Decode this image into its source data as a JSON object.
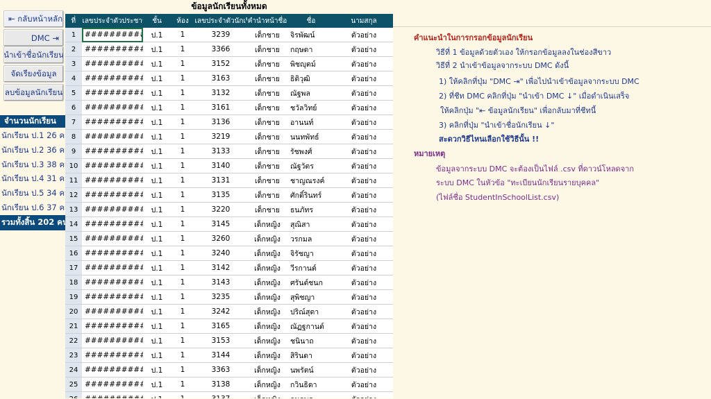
{
  "left_panel": {
    "back_button": "⇤ กลับหน้าหลัก",
    "dmc_button": "DMC ⇥",
    "import_button": "นำเข้าชื่อนักเรียน",
    "sort_button": "จัดเรียงข้อมูล",
    "delete_button": "ลบข้อมูลนักเรียน",
    "count_header": "จำนวนนักเรียน",
    "counts": [
      "นักเรียน ป.1  26 คน",
      "นักเรียน ป.2  36 คน",
      "นักเรียน ป.3  38 คน",
      "นักเรียน ป.4  31 คน",
      "นักเรียน ป.5  34 คน",
      "นักเรียน ป.6  37 คน"
    ],
    "total": "รวมทั้งสิ้น  202  คน"
  },
  "sheet": {
    "title": "ข้อมูลนักเรียนทั้งหมด",
    "columns": [
      "ที่",
      "เลขประจำตัวประชาชน",
      "ชั้น",
      "ห้อง",
      "เลขประจำตัวนักเรียน",
      "คำนำหน้าชื่อ",
      "ชื่อ",
      "นามสกุล"
    ],
    "rows": [
      [
        "1",
        "###############",
        "ป.1",
        "1",
        "3239",
        "เด็กชาย",
        "จิรพัฒน์",
        "ตัวอย่าง"
      ],
      [
        "2",
        "###############",
        "ป.1",
        "1",
        "3366",
        "เด็กชาย",
        "กฤษดา",
        "ตัวอย่าง"
      ],
      [
        "3",
        "###############",
        "ป.1",
        "1",
        "3152",
        "เด็กชาย",
        "พิชญุตม์",
        "ตัวอย่าง"
      ],
      [
        "4",
        "###############",
        "ป.1",
        "1",
        "3163",
        "เด็กชาย",
        "ธิติวุฒิ",
        "ตัวอย่าง"
      ],
      [
        "5",
        "###############",
        "ป.1",
        "1",
        "3132",
        "เด็กชาย",
        "ณัฐพล",
        "ตัวอย่าง"
      ],
      [
        "6",
        "###############",
        "ป.1",
        "1",
        "3161",
        "เด็กชาย",
        "ชวัลวิทย์",
        "ตัวอย่าง"
      ],
      [
        "7",
        "###############",
        "ป.1",
        "1",
        "3136",
        "เด็กชาย",
        "อานนท์",
        "ตัวอย่าง"
      ],
      [
        "8",
        "###############",
        "ป.1",
        "1",
        "3219",
        "เด็กชาย",
        "นนทพัทธ์",
        "ตัวอย่าง"
      ],
      [
        "9",
        "###############",
        "ป.1",
        "1",
        "3133",
        "เด็กชาย",
        "รัชพงศ์",
        "ตัวอย่าง"
      ],
      [
        "10",
        "###############",
        "ป.1",
        "1",
        "3140",
        "เด็กชาย",
        "ณัฐวัตร",
        "ตัวอย่าง"
      ],
      [
        "11",
        "###############",
        "ป.1",
        "1",
        "3131",
        "เด็กชาย",
        "ชาญณรงค์",
        "ตัวอย่าง"
      ],
      [
        "12",
        "###############",
        "ป.1",
        "1",
        "3135",
        "เด็กชาย",
        "ศักดิ์รินทร์",
        "ตัวอย่าง"
      ],
      [
        "13",
        "###############",
        "ป.1",
        "1",
        "3220",
        "เด็กชาย",
        "ธนภัทร",
        "ตัวอย่าง"
      ],
      [
        "14",
        "###############",
        "ป.1",
        "1",
        "3145",
        "เด็กหญิง",
        "สุณิสา",
        "ตัวอย่าง"
      ],
      [
        "15",
        "###############",
        "ป.1",
        "1",
        "3260",
        "เด็กหญิง",
        "วรกมล",
        "ตัวอย่าง"
      ],
      [
        "16",
        "###############",
        "ป.1",
        "1",
        "3240",
        "เด็กหญิง",
        "จิรัชญา",
        "ตัวอย่าง"
      ],
      [
        "17",
        "###############",
        "ป.1",
        "1",
        "3142",
        "เด็กหญิง",
        "วีรกานต์",
        "ตัวอย่าง"
      ],
      [
        "18",
        "###############",
        "ป.1",
        "1",
        "3143",
        "เด็กหญิง",
        "ศรันต์ชนก",
        "ตัวอย่าง"
      ],
      [
        "19",
        "###############",
        "ป.1",
        "1",
        "3235",
        "เด็กหญิง",
        "สุพิชญา",
        "ตัวอย่าง"
      ],
      [
        "20",
        "###############",
        "ป.1",
        "1",
        "3242",
        "เด็กหญิง",
        "ปริณ์สุดา",
        "ตัวอย่าง"
      ],
      [
        "21",
        "###############",
        "ป.1",
        "1",
        "3165",
        "เด็กหญิง",
        "ณัฏฐกานต์",
        "ตัวอย่าง"
      ],
      [
        "22",
        "###############",
        "ป.1",
        "1",
        "3153",
        "เด็กหญิง",
        "ชนินาถ",
        "ตัวอย่าง"
      ],
      [
        "23",
        "###############",
        "ป.1",
        "1",
        "3144",
        "เด็กหญิง",
        "สิรินดา",
        "ตัวอย่าง"
      ],
      [
        "24",
        "###############",
        "ป.1",
        "1",
        "3363",
        "เด็กหญิง",
        "นพรัตน์",
        "ตัวอย่าง"
      ],
      [
        "25",
        "###############",
        "ป.1",
        "1",
        "3138",
        "เด็กหญิง",
        "กวินธิดา",
        "ตัวอย่าง"
      ],
      [
        "26",
        "###############",
        "ป.1",
        "1",
        "3137",
        "เด็กหญิง",
        "กนกพร",
        "ตัวอย่าง"
      ]
    ]
  },
  "instructions": {
    "heading": "คำแนะนำในการกรอกข้อมูลนักเรียน",
    "method1": "วิธีที่ 1 ข้อมูลด้วยตัวเอง ให้กรอกข้อมูลลงในช่องสีขาว",
    "method2": "วิธีที่ 2 นำเข้าข้อมูลจากระบบ DMC ดังนี้",
    "step1": "1) ให้คลิกที่ปุ่ม \"DMC ⇥\" เพื่อไปนำเข้าข้อมูลจากระบบ DMC",
    "step2": "2) ที่ชีท DMC คลิกที่ปุ่ม \"นำเข้า DMC ↓\" เมื่อดำเนินเสร็จ",
    "step2b": "ให้คลิกปุ่ม \"⇤ ข้อมูลนักเรียน\" เพื่อกลับมาที่ชีทนี้",
    "step3": "3) คลิกที่ปุ่ม \"นำเข้าชื่อนักเรียน ↓\"",
    "tip": "สะดวกวิธีไหนเลือกใช้วิธีนั้น !!",
    "note_heading": "หมายเหตุ",
    "note1": "ข้อมูลจากระบบ DMC จะต้องเป็นไฟล์ .csv ที่ดาวน์โหลดจาก",
    "note2": "ระบบ DMC ในหัวข้อ \"ทะเบียนนักเรียนรายบุคคล\"",
    "note3": "(ไฟล์ชื่อ StudentInSchoolList.csv)"
  }
}
